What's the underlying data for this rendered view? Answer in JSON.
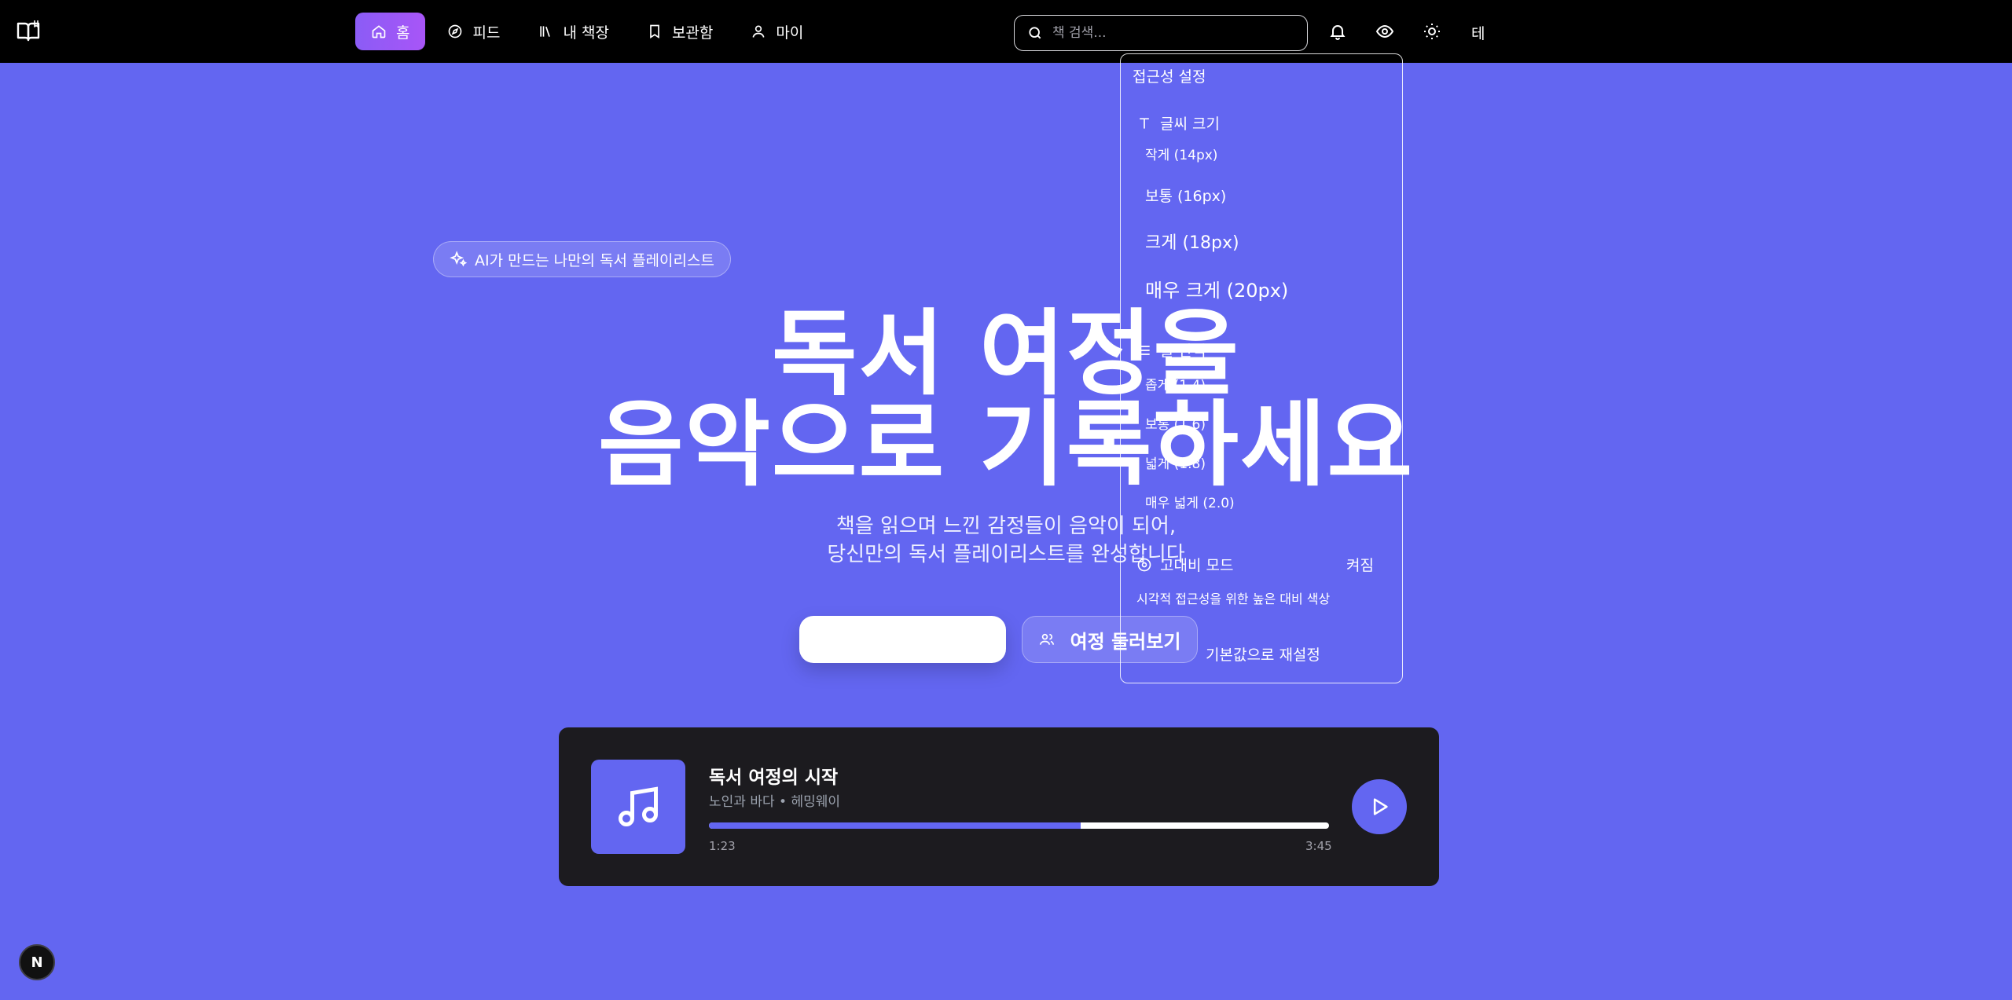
{
  "nav": {
    "items": [
      {
        "label": "홈",
        "icon": "home-icon",
        "active": true
      },
      {
        "label": "피드",
        "icon": "compass-icon",
        "active": false
      },
      {
        "label": "내 책장",
        "icon": "library-icon",
        "active": false
      },
      {
        "label": "보관함",
        "icon": "bookmark-icon",
        "active": false
      },
      {
        "label": "마이",
        "icon": "user-icon",
        "active": false
      }
    ]
  },
  "search": {
    "placeholder": "책 검색..."
  },
  "header_icons": [
    "bell-icon",
    "eye-icon",
    "sun-icon"
  ],
  "theme_label": "테",
  "hero": {
    "badge": "AI가 만드는 나만의 독서 플레이리스트",
    "title_line1": "독서 여정을",
    "title_line2": "음악으로 기록하세요",
    "subtitle_line1": "책을 읽으며 느낀 감정들이 음악이 되어,",
    "subtitle_line2": "당신만의 독서 플레이리스트를 완성합니다",
    "primary_button": "",
    "secondary_button": "여정 둘러보기"
  },
  "player": {
    "title": "독서 여정의 시작",
    "meta": "노인과 바다 • 헤밍웨이",
    "current_time": "1:23",
    "total_time": "3:45",
    "progress": 0.6
  },
  "accessibility": {
    "heading": "접근성 설정",
    "font_size_label": "글씨 크기",
    "font_sizes": [
      "작게 (14px)",
      "보통 (16px)",
      "크게 (18px)",
      "매우 크게 (20px)"
    ],
    "line_height_label": "줄 간격",
    "line_heights": [
      "좁게 (1.4)",
      "보통 (1.6)",
      "넓게 (1.8)",
      "매우 넓게 (2.0)"
    ],
    "high_contrast_label": "고대비 모드",
    "high_contrast_state": "켜짐",
    "high_contrast_desc": "시각적 접근성을 위한 높은 대비 색상",
    "reset_label": "기본값으로 재설정"
  },
  "dev_badge": "N",
  "colors": {
    "background": "#6366f1",
    "topbar": "#000000",
    "player": "#1c1b1f",
    "accent": "#8b5cf6"
  }
}
